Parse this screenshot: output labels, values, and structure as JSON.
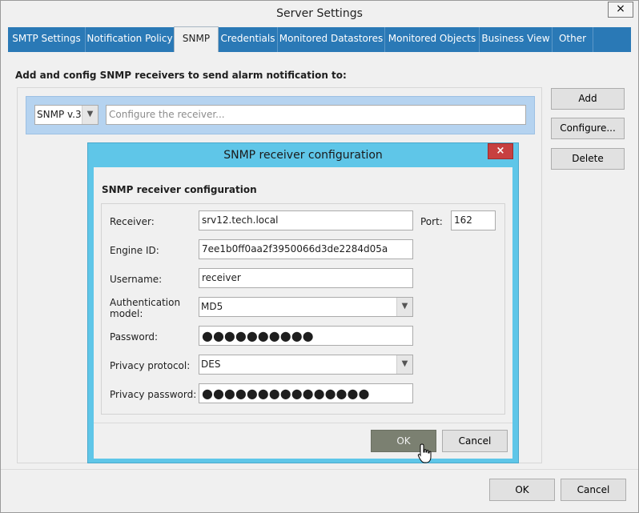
{
  "window": {
    "title": "Server Settings",
    "close_glyph": "×"
  },
  "tabs": [
    {
      "label": "SMTP Settings",
      "active": false
    },
    {
      "label": "Notification Policy",
      "active": false
    },
    {
      "label": "SNMP",
      "active": true
    },
    {
      "label": "Credentials",
      "active": false
    },
    {
      "label": "Monitored Datastores",
      "active": false
    },
    {
      "label": "Monitored Objects",
      "active": false
    },
    {
      "label": "Business View",
      "active": false
    },
    {
      "label": "Other",
      "active": false
    }
  ],
  "snmp": {
    "heading": "Add and config SNMP receivers to send alarm notification to:",
    "version_select": {
      "value": "SNMP v.3",
      "options": [
        "SNMP v.3"
      ]
    },
    "receiver_placeholder": "Configure the receiver...",
    "buttons": {
      "add": "Add",
      "configure": "Configure...",
      "delete": "Delete"
    }
  },
  "dialog": {
    "title": "SNMP receiver configuration",
    "heading": "SNMP receiver configuration",
    "close_glyph": "×",
    "fields": {
      "receiver": {
        "label": "Receiver:",
        "value": "srv12.tech.local"
      },
      "port": {
        "label": "Port:",
        "value": "162"
      },
      "engine_id": {
        "label": "Engine ID:",
        "value": "7ee1b0ff0aa2f3950066d3de2284d05a"
      },
      "username": {
        "label": "Username:",
        "value": "receiver"
      },
      "auth_model": {
        "label_line1": "Authentication",
        "label_line2": "model:",
        "value": "MD5"
      },
      "password": {
        "label": "Password:",
        "value": "●●●●●●●●●●"
      },
      "privacy_protocol": {
        "label": "Privacy protocol:",
        "value": "DES"
      },
      "privacy_password": {
        "label": "Privacy password:",
        "value": "●●●●●●●●●●●●●●●"
      }
    },
    "buttons": {
      "ok": "OK",
      "cancel": "Cancel"
    }
  },
  "footer": {
    "ok": "OK",
    "cancel": "Cancel"
  },
  "colors": {
    "tab_bar": "#2a79b6",
    "dialog_frame": "#5fc6e8",
    "receiver_row": "#b5d3f0",
    "close_red": "#c74040",
    "ok_pressed": "#7b8071"
  }
}
